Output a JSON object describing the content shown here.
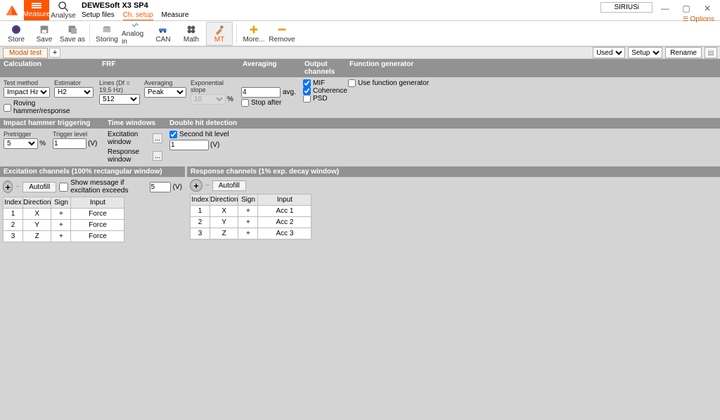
{
  "app": {
    "title": "DEWESoft X3 SP4",
    "device": "SIRIUSi",
    "options": "Options"
  },
  "modes": {
    "measure": "Measure",
    "analyse": "Analyse"
  },
  "subtabs": {
    "setup_files": "Setup files",
    "ch_setup": "Ch. setup",
    "measure": "Measure"
  },
  "toolbar": {
    "store": "Store",
    "save": "Save",
    "saveas": "Save as",
    "storing": "Storing",
    "analogin": "Analog in",
    "can": "CAN",
    "math": "Math",
    "mt": "MT",
    "more": "More...",
    "remove": "Remove"
  },
  "tabbar": {
    "modal_test": "Modal test",
    "plus": "+",
    "used": "Used",
    "setup": "Setup",
    "rename": "Rename"
  },
  "sech1": {
    "calculation": "Calculation",
    "frf": "FRF",
    "averaging": "Averaging",
    "output": "Output channels",
    "fg": "Function generator"
  },
  "calc": {
    "test_method": "Test method",
    "test_method_val": "Impact Hammer",
    "estimator": "Estimator",
    "estimator_val": "H2",
    "lines": "Lines (Df = 19,5 Hz)",
    "lines_val": "512",
    "averaging_label": "Averaging",
    "averaging_val": "Peak",
    "exp_slope": "Exponential slope",
    "exp_slope_val": "10",
    "pct": "%",
    "avg_count": "4",
    "avg_suffix": "avg.",
    "stop_after": "Stop after",
    "mif": "MIF",
    "coherence": "Coherence",
    "psd": "PSD",
    "use_fg": "Use function generator",
    "roving": "Roving hammer/response"
  },
  "sech2": {
    "impact": "Impact hammer triggering",
    "timewin": "Time windows",
    "double": "Double hit detection"
  },
  "trig": {
    "pretrigger": "Pretrigger",
    "pretrigger_val": "5",
    "pct": "%",
    "trigger_level": "Trigger level",
    "trigger_level_val": "1",
    "unit": "(V)",
    "excitation_window": "Excitation window",
    "response_window": "Response window",
    "second_hit": "Second hit level",
    "second_hit_val": "1",
    "unit2": "(V)"
  },
  "exc_panel": {
    "title": "Excitation channels (100% rectangular window)",
    "autofill": "Autofill",
    "show_msg": "Show message if excitation exceeds",
    "show_msg_val": "5",
    "unit": "(V)",
    "headers": [
      "Index",
      "Direction",
      "Sign",
      "Input"
    ],
    "rows": [
      {
        "i": "1",
        "d": "X",
        "s": "+",
        "in": "Force"
      },
      {
        "i": "2",
        "d": "Y",
        "s": "+",
        "in": "Force"
      },
      {
        "i": "3",
        "d": "Z",
        "s": "+",
        "in": "Force"
      }
    ]
  },
  "resp_panel": {
    "title": "Response channels (1% exp. decay window)",
    "autofill": "Autofill",
    "headers": [
      "Index",
      "Direction",
      "Sign",
      "Input"
    ],
    "rows": [
      {
        "i": "1",
        "d": "X",
        "s": "+",
        "in": "Acc 1"
      },
      {
        "i": "2",
        "d": "Y",
        "s": "+",
        "in": "Acc 2"
      },
      {
        "i": "3",
        "d": "Z",
        "s": "+",
        "in": "Acc 3"
      }
    ]
  }
}
